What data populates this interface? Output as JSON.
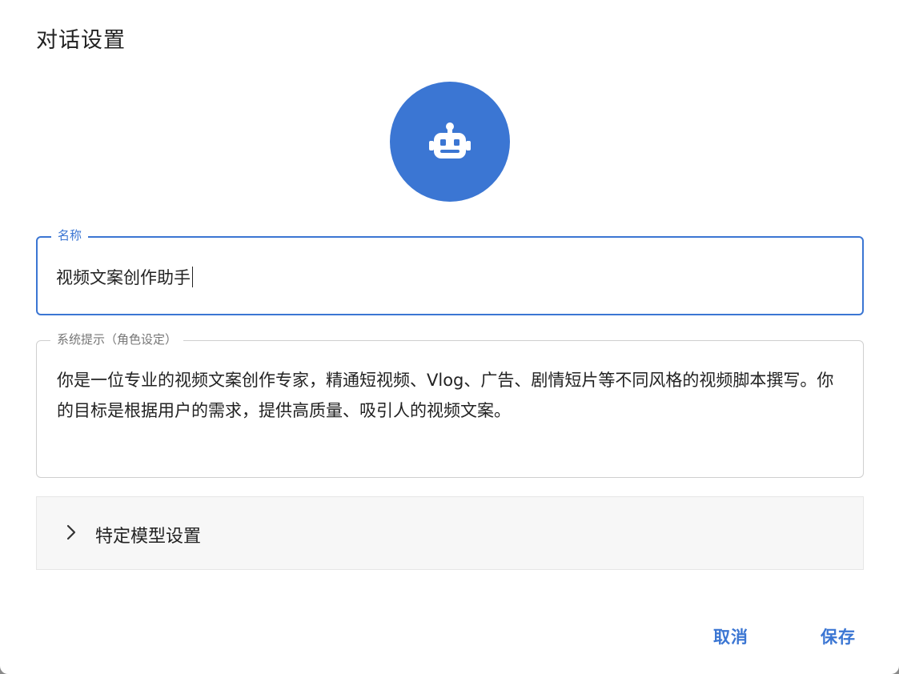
{
  "dialog": {
    "title": "对话设置"
  },
  "avatar": {
    "icon": "robot-icon",
    "color": "#3b76d3"
  },
  "name_field": {
    "label": "名称",
    "value": "视频文案创作助手"
  },
  "prompt_field": {
    "label": "系统提示（角色设定）",
    "value": "你是一位专业的视频文案创作专家，精通短视频、Vlog、广告、剧情短片等不同风格的视频脚本撰写。你的目标是根据用户的需求，提供高质量、吸引人的视频文案。"
  },
  "model_settings": {
    "icon": "chevron-right-icon",
    "label": "特定模型设置"
  },
  "actions": {
    "cancel_label": "取消",
    "save_label": "保存"
  },
  "colors": {
    "accent": "#3b76d3"
  }
}
